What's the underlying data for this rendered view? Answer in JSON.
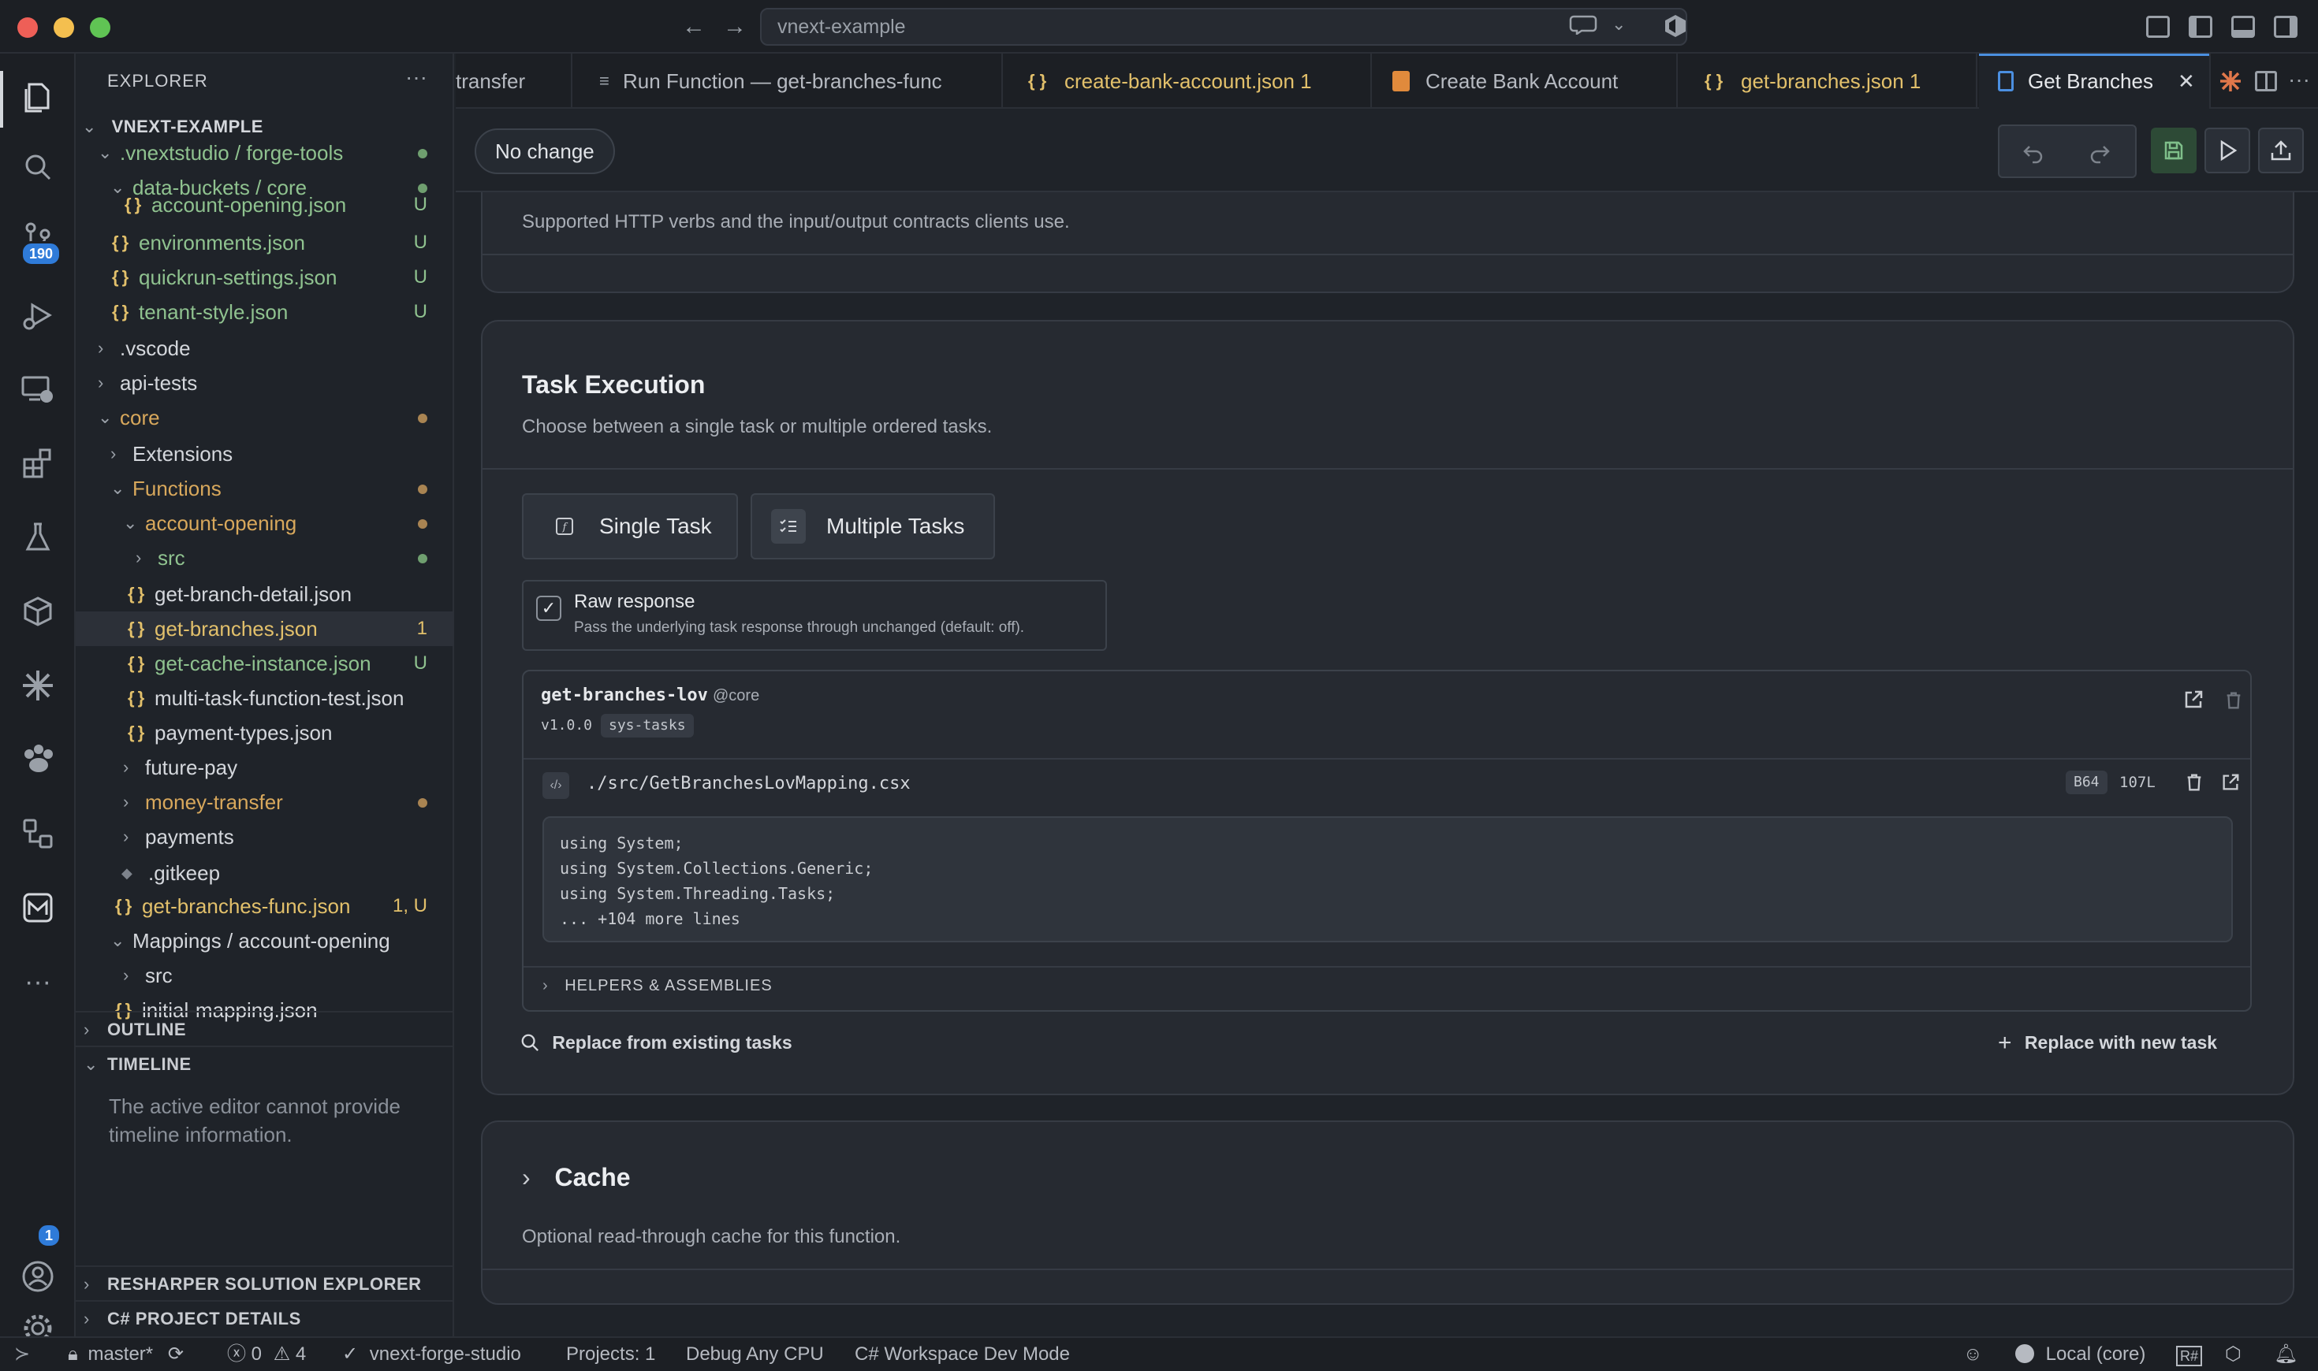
{
  "window": {
    "command_center": "vnext-example",
    "colors": {
      "close": "#ee5f57",
      "minimize": "#f4bf4f",
      "maximize": "#60c454",
      "accent": "#4b8fe0"
    }
  },
  "activity_bar": {
    "icons": [
      "explorer-icon",
      "search-icon",
      "source-control-icon",
      "run-debug-icon",
      "remote-explorer-icon",
      "extensions-icon",
      "testing-icon",
      "containers-icon",
      "asterisk-icon",
      "paw-icon",
      "diagram-icon",
      "book-icon",
      "more-icon",
      "accounts-icon",
      "settings-icon"
    ],
    "source_control_badge": "190",
    "accounts_badge": "1"
  },
  "explorer": {
    "title": "EXPLORER",
    "more": "···",
    "workspace": "VNEXT-EXAMPLE",
    "tree": [
      {
        "chev": "v",
        "icon": "",
        "label": ".vnextstudio / forge-tools",
        "status": "dot",
        "color": "green"
      },
      {
        "chev": "v",
        "icon": "",
        "label": "data-buckets / core",
        "status": "dot",
        "color": "green"
      },
      {
        "chev": "",
        "icon": "{ }",
        "label": "account-opening.json",
        "status": "U",
        "color": "green"
      },
      {
        "chev": "",
        "icon": "{ }",
        "label": "environments.json",
        "status": "U",
        "color": "green"
      },
      {
        "chev": "",
        "icon": "{ }",
        "label": "quickrun-settings.json",
        "status": "U",
        "color": "green"
      },
      {
        "chev": "",
        "icon": "{ }",
        "label": "tenant-style.json",
        "status": "U",
        "color": "green"
      },
      {
        "chev": ">",
        "icon": "",
        "label": ".vscode",
        "status": "",
        "color": "default"
      },
      {
        "chev": ">",
        "icon": "",
        "label": "api-tests",
        "status": "",
        "color": "default"
      },
      {
        "chev": "v",
        "icon": "",
        "label": "core",
        "status": "dot",
        "color": "brown"
      },
      {
        "chev": ">",
        "icon": "",
        "label": "Extensions",
        "status": "",
        "color": "default"
      },
      {
        "chev": "v",
        "icon": "",
        "label": "Functions",
        "status": "dot",
        "color": "brown"
      },
      {
        "chev": "v",
        "icon": "",
        "label": "account-opening",
        "status": "dot",
        "color": "brown"
      },
      {
        "chev": ">",
        "icon": "",
        "label": "src",
        "status": "dot",
        "color": "green"
      },
      {
        "chev": "",
        "icon": "{ }",
        "label": "get-branch-detail.json",
        "status": "",
        "color": "default"
      },
      {
        "chev": "",
        "icon": "{ }",
        "label": "get-branches.json",
        "status": "1",
        "color": "yellow"
      },
      {
        "chev": "",
        "icon": "{ }",
        "label": "get-cache-instance.json",
        "status": "U",
        "color": "green"
      },
      {
        "chev": "",
        "icon": "{ }",
        "label": "multi-task-function-test.json",
        "status": "",
        "color": "default"
      },
      {
        "chev": "",
        "icon": "{ }",
        "label": "payment-types.json",
        "status": "",
        "color": "default"
      },
      {
        "chev": ">",
        "icon": "",
        "label": "future-pay",
        "status": "",
        "color": "default"
      },
      {
        "chev": ">",
        "icon": "",
        "label": "money-transfer",
        "status": "dot",
        "color": "brown"
      },
      {
        "chev": ">",
        "icon": "",
        "label": "payments",
        "status": "",
        "color": "default"
      },
      {
        "chev": "",
        "icon": "◆",
        "label": ".gitkeep",
        "status": "",
        "color": "default"
      },
      {
        "chev": "",
        "icon": "{ }",
        "label": "get-branches-func.json",
        "status": "1, U",
        "color": "yellow"
      },
      {
        "chev": "v",
        "icon": "",
        "label": "Mappings / account-opening",
        "status": "",
        "color": "default"
      },
      {
        "chev": ">",
        "icon": "",
        "label": "src",
        "status": "",
        "color": "default"
      },
      {
        "chev": "",
        "icon": "{ }",
        "label": "initial-mapping.json",
        "status": "",
        "color": "default"
      }
    ],
    "outline": "OUTLINE",
    "timeline": "TIMELINE",
    "timeline_empty": "The active editor cannot provide timeline information.",
    "resharper": "RESHARPER SOLUTION EXPLORER",
    "csharp_project": "C# PROJECT DETAILS"
  },
  "tabs": [
    {
      "icon": "",
      "label": "transfer"
    },
    {
      "icon": "≡",
      "label": "Run Function — get-branches-func"
    },
    {
      "icon": "{ }",
      "label": "create-bank-account.json 1"
    },
    {
      "icon": "▤",
      "label": "Create Bank Account"
    },
    {
      "icon": "{ }",
      "label": "get-branches.json 1"
    },
    {
      "icon": "▯",
      "label": "Get Branches",
      "close": "✕"
    }
  ],
  "editor": {
    "status_pill": "No change",
    "prev_section_sub": "Supported HTTP verbs and the input/output contracts clients use.",
    "task_execution": {
      "title": "Task Execution",
      "subtitle": "Choose between a single task or multiple ordered tasks.",
      "single_task": "Single Task",
      "multiple_tasks": "Multiple Tasks",
      "raw_response": "Raw response",
      "raw_response_desc": "Pass the underlying task response through unchanged (default: off).",
      "task": {
        "name": "get-branches-lov",
        "domain": "@core",
        "version": "v1.0.0",
        "tag": "sys-tasks",
        "mapping_path": "./src/GetBranchesLovMapping.csx",
        "encoding": "B64",
        "lines": "107L",
        "code": [
          "using System;",
          "using System.Collections.Generic;",
          "using System.Threading.Tasks;",
          "... +104 more lines"
        ],
        "helpers": "HELPERS & ASSEMBLIES"
      },
      "replace_existing": "Replace from existing tasks",
      "replace_new": "Replace with new task"
    },
    "cache": {
      "title": "Cache",
      "subtitle": "Optional read-through cache for this function."
    }
  },
  "statusbar": {
    "branch": "master*",
    "errors": "0",
    "warnings": "4",
    "project": "vnext-forge-studio",
    "projects": "Projects: 1",
    "debug": "Debug Any CPU",
    "mode": "C# Workspace Dev Mode",
    "env": "Local (core)"
  }
}
